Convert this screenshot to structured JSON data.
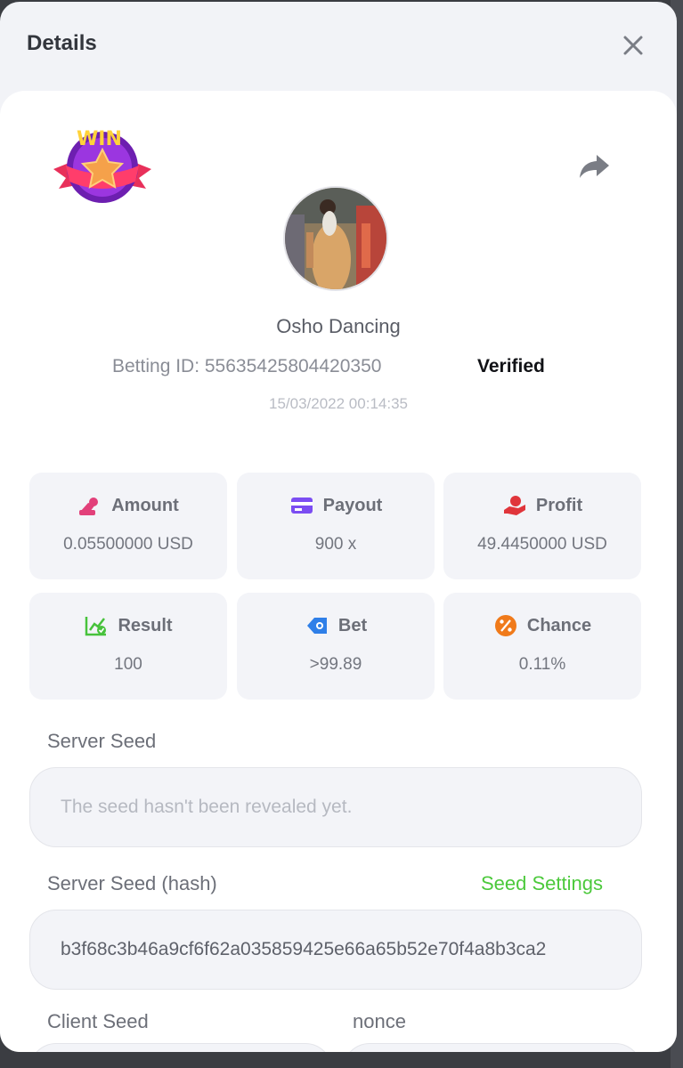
{
  "modal": {
    "title": "Details"
  },
  "game": {
    "name": "Osho Dancing",
    "betting_id_label": "Betting ID: 55635425804420350",
    "verified_label": "Verified",
    "timestamp": "15/03/2022 00:14:35",
    "badge_text": "WIN"
  },
  "stats": [
    {
      "label": "Amount",
      "value": "0.05500000 USD",
      "icon": "coins-icon",
      "color": "#e2407a"
    },
    {
      "label": "Payout",
      "value": "900 x",
      "icon": "card-icon",
      "color": "#7b4df2"
    },
    {
      "label": "Profit",
      "value": "49.4450000 USD",
      "icon": "hand-money-icon",
      "color": "#e0353b"
    },
    {
      "label": "Result",
      "value": "100",
      "icon": "chart-check-icon",
      "color": "#47c23c"
    },
    {
      "label": "Bet",
      "value": ">99.89",
      "icon": "ticket-icon",
      "color": "#2f7fe8"
    },
    {
      "label": "Chance",
      "value": "0.11%",
      "icon": "percent-icon",
      "color": "#f07a1a"
    }
  ],
  "server_seed": {
    "label": "Server Seed",
    "placeholder": "The seed hasn't been revealed yet."
  },
  "server_seed_hash": {
    "label": "Server Seed (hash)",
    "link": "Seed Settings",
    "value": "b3f68c3b46a9cf6f62a035859425e66a65b52e70f4a8b3ca2"
  },
  "client_seed": {
    "label": "Client Seed"
  },
  "nonce": {
    "label": "nonce"
  },
  "colors": {
    "accent_green": "#4cc93c",
    "title": "#33363d"
  }
}
